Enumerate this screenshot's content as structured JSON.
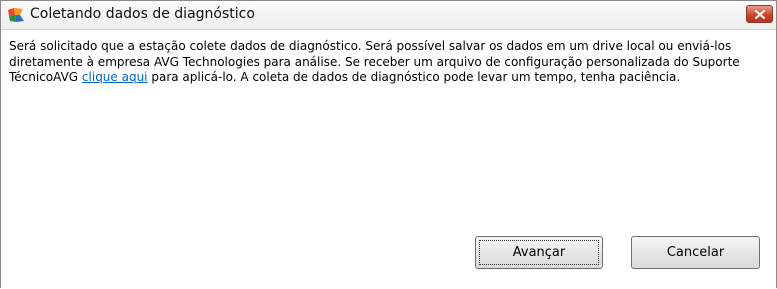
{
  "window": {
    "title": "Coletando dados de diagnóstico",
    "icon": "avg-logo-icon",
    "close_icon": "close-icon",
    "accent_colors": {
      "close": "#c8452b",
      "link": "#0066cc"
    }
  },
  "message": {
    "text_before": "Será solicitado que a estação colete dados de diagnóstico. Será possível salvar os dados em um drive local ou enviá-los diretamente à empresa AVG Technologies para análise. Se receber um arquivo de configuração personalizada do Suporte TécnicoAVG ",
    "link": "clique aqui",
    "text_after": " para aplicá-lo. A coleta de dados de diagnóstico pode levar um tempo, tenha paciência."
  },
  "buttons": {
    "next": "Avançar",
    "cancel": "Cancelar"
  }
}
